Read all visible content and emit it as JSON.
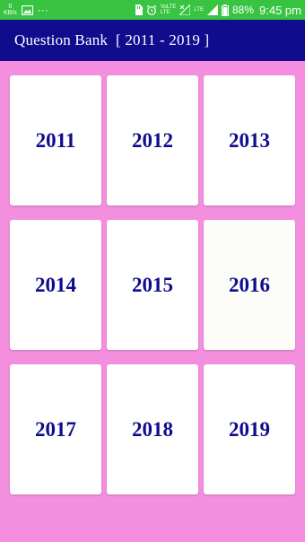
{
  "status_bar": {
    "kb_value": "0",
    "kb_unit": "KB/s",
    "dots": "···",
    "volte_text": "VoLTE",
    "lte_text": "LTE",
    "lte2_text": "LTE",
    "battery_text": "88%",
    "time": "9:45 pm",
    "icons": [
      "image-icon",
      "dots-icon",
      "sd-card-icon",
      "alarm-icon",
      "volte-icon",
      "lte-icon",
      "signal-icon",
      "battery-icon"
    ]
  },
  "app_bar": {
    "title": "Question Bank  [ 2011 - 2019 ]",
    "background": "#0f0c8d"
  },
  "colors": {
    "page_background": "#f38fde",
    "card_background": "#ffffff",
    "card_text": "#0f0c8d",
    "status_bar": "#38c441"
  },
  "years": [
    {
      "label": "2011"
    },
    {
      "label": "2012"
    },
    {
      "label": "2013"
    },
    {
      "label": "2014"
    },
    {
      "label": "2015"
    },
    {
      "label": "2016"
    },
    {
      "label": "2017"
    },
    {
      "label": "2018"
    },
    {
      "label": "2019"
    }
  ]
}
